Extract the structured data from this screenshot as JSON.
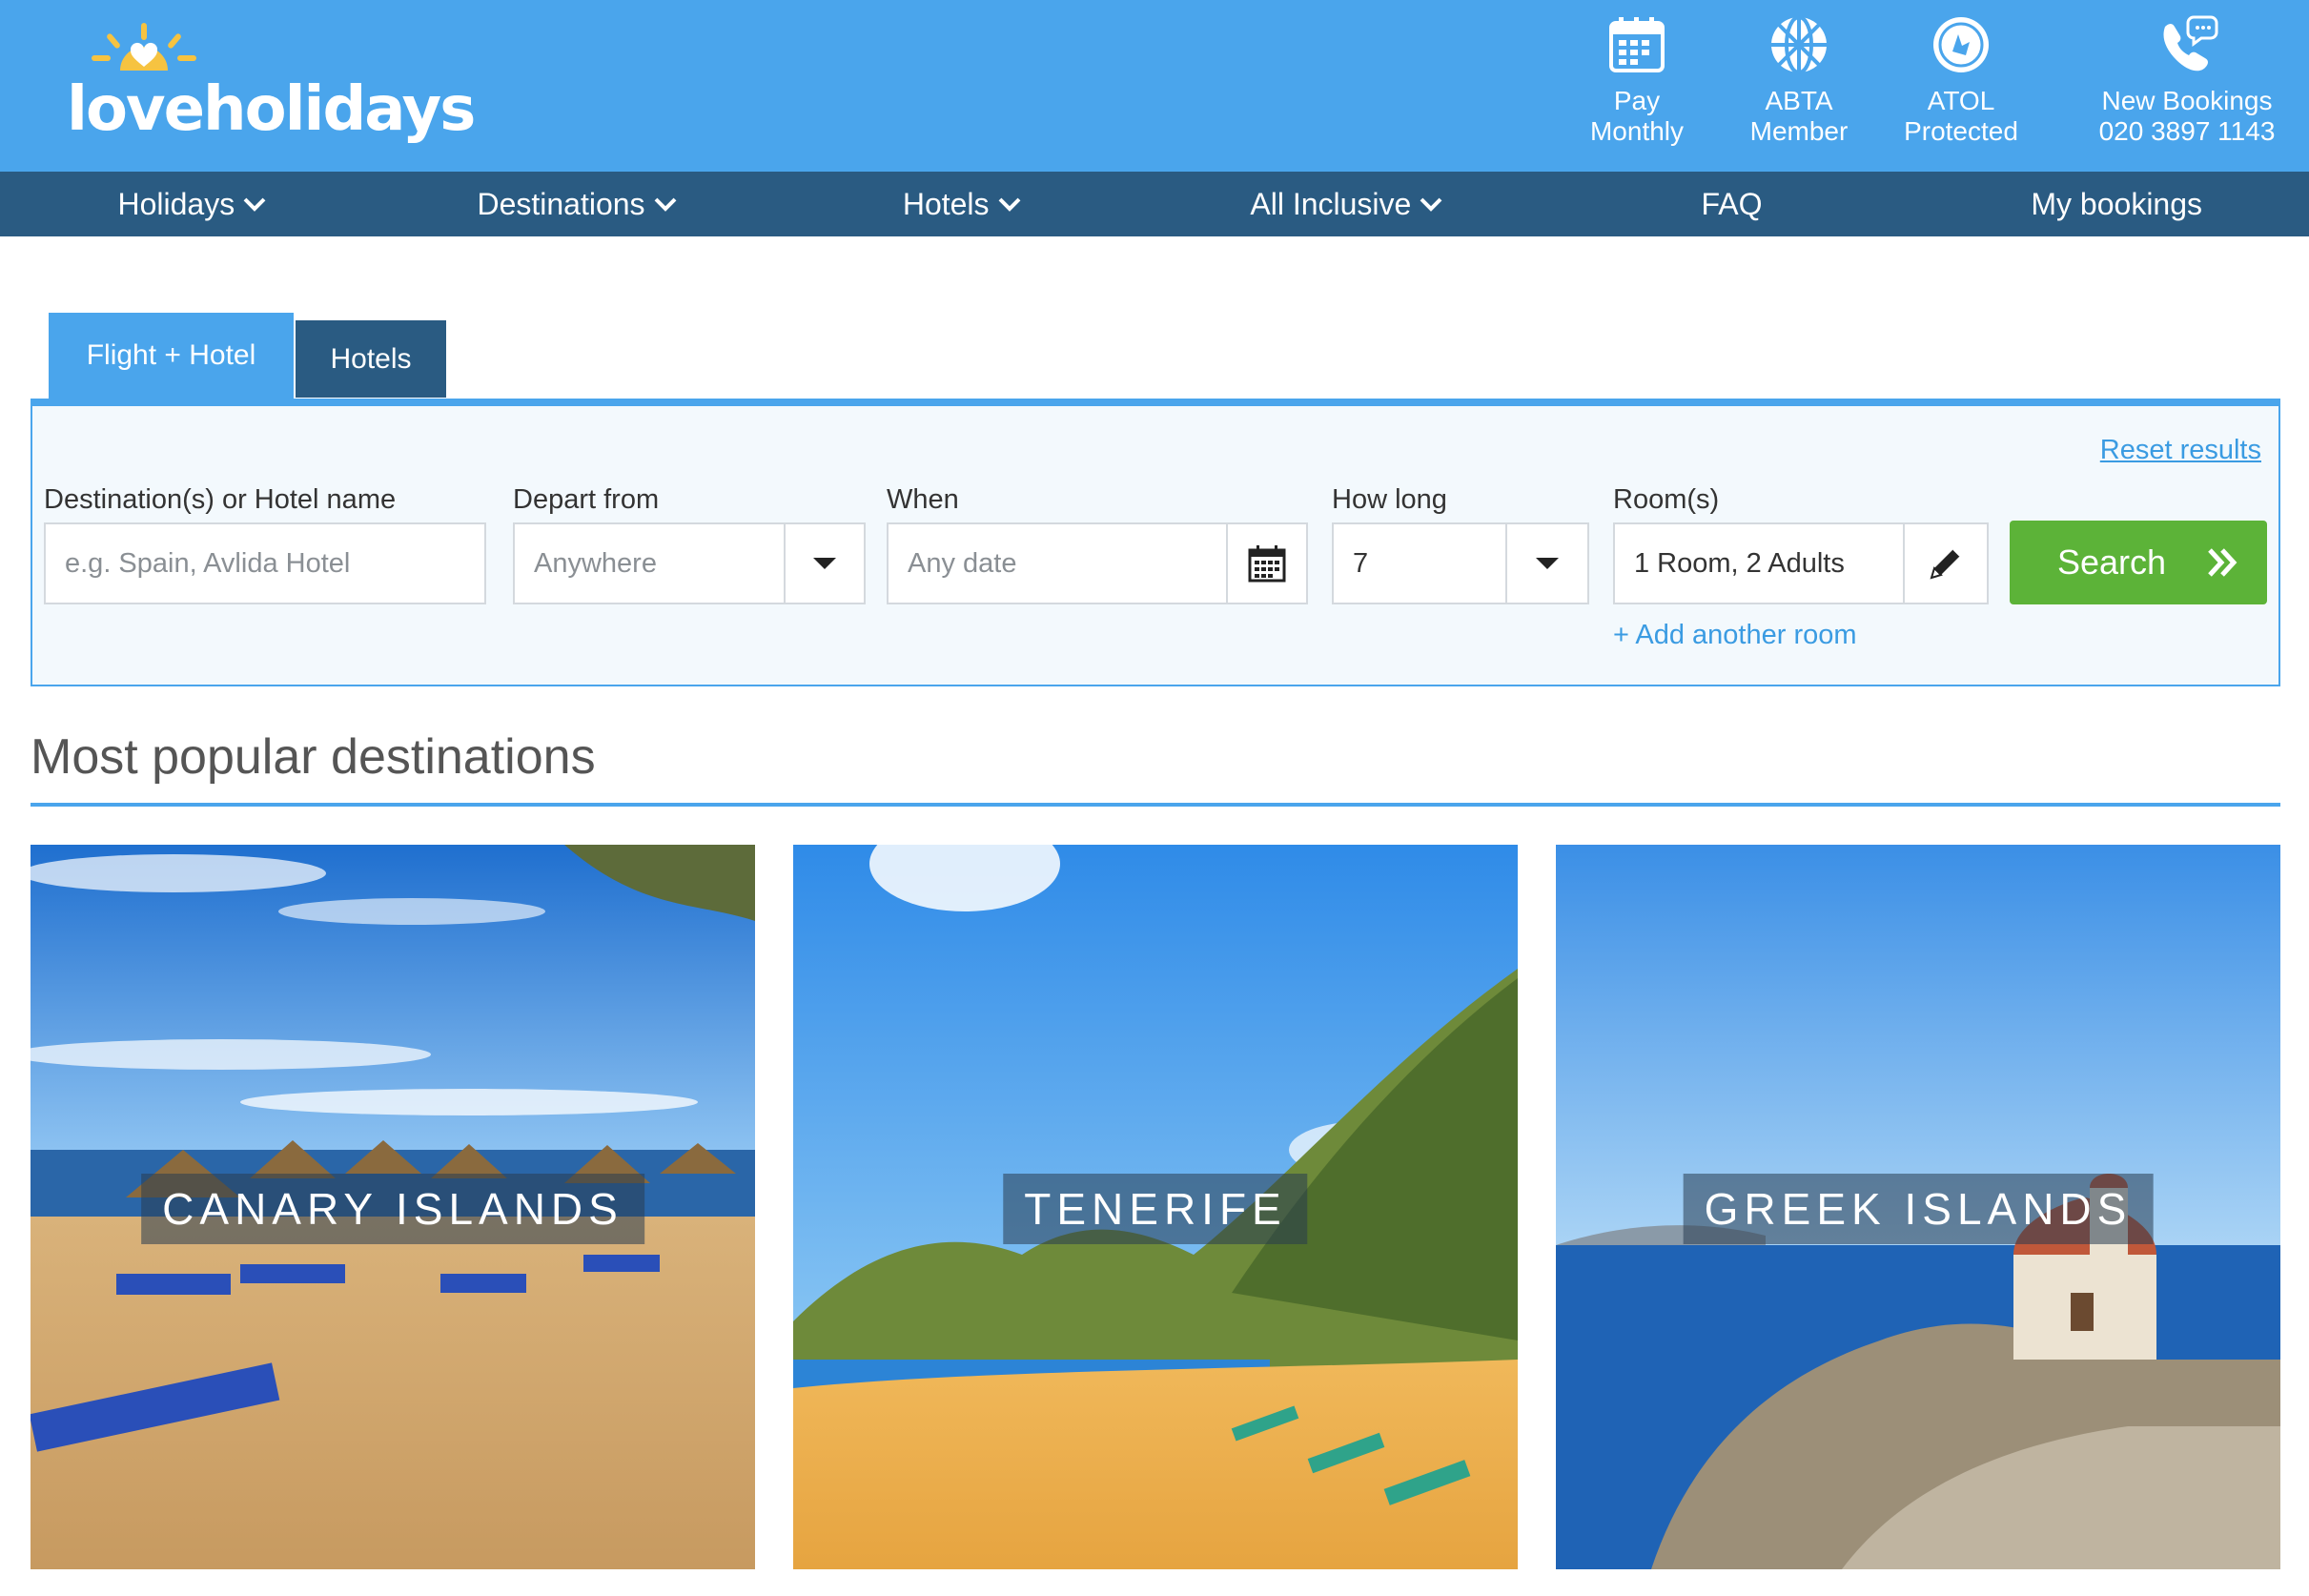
{
  "brand": {
    "logo_text": "loveholidays",
    "color_primary": "#4aa5ec",
    "color_nav": "#2a5b82",
    "color_search": "#5cb338"
  },
  "header": {
    "items": [
      {
        "icon": "calendar-icon",
        "line1": "Pay",
        "line2": "Monthly"
      },
      {
        "icon": "abta-globe-icon",
        "line1": "ABTA",
        "line2": "Member"
      },
      {
        "icon": "atol-badge-icon",
        "line1": "ATOL",
        "line2": "Protected"
      },
      {
        "icon": "phone-chat-icon",
        "line1": "New Bookings",
        "line2": "020 3897 1143"
      }
    ]
  },
  "nav": {
    "items": [
      {
        "label": "Holidays",
        "dropdown": true
      },
      {
        "label": "Destinations",
        "dropdown": true
      },
      {
        "label": "Hotels",
        "dropdown": true
      },
      {
        "label": "All Inclusive",
        "dropdown": true
      },
      {
        "label": "FAQ",
        "dropdown": false
      },
      {
        "label": "My bookings",
        "dropdown": false
      }
    ]
  },
  "search": {
    "tabs": [
      {
        "label": "Flight + Hotel",
        "active": true
      },
      {
        "label": "Hotels",
        "active": false
      }
    ],
    "reset_label": "Reset results",
    "destination": {
      "label": "Destination(s) or Hotel name",
      "placeholder": "e.g. Spain, Avlida Hotel"
    },
    "depart": {
      "label": "Depart from",
      "placeholder": "Anywhere"
    },
    "when": {
      "label": "When",
      "placeholder": "Any date"
    },
    "how_long": {
      "label": "How long",
      "value": "7"
    },
    "rooms": {
      "label": "Room(s)",
      "value": "1 Room, 2 Adults"
    },
    "add_room_label": "+ Add another room",
    "search_label": "Search"
  },
  "popular": {
    "title": "Most popular destinations",
    "cards": [
      {
        "label": "CANARY ISLANDS"
      },
      {
        "label": "TENERIFE"
      },
      {
        "label": "GREEK ISLANDS"
      }
    ]
  }
}
